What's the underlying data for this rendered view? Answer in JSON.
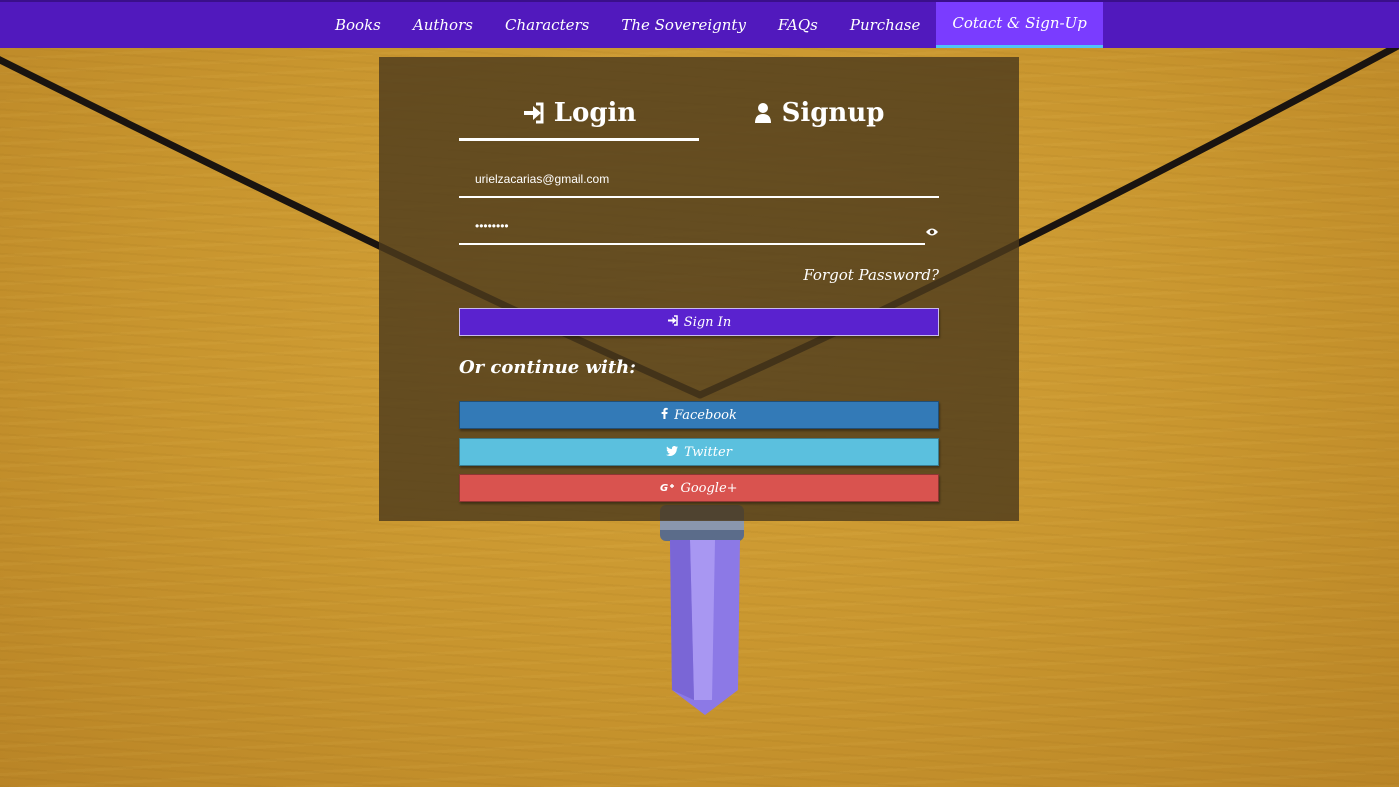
{
  "nav": {
    "items": [
      "Books",
      "Authors",
      "Characters",
      "The Sovereignty",
      "FAQs",
      "Purchase",
      "Cotact & Sign-Up"
    ],
    "active_index": 6
  },
  "auth": {
    "tabs": {
      "login": "Login",
      "signup": "Signup",
      "active": "login"
    },
    "email": {
      "value": "urielzacarias@gmail.com"
    },
    "password": {
      "value": "••••••••"
    },
    "forgot_label": "Forgot Password?",
    "signin_label": "Sign In",
    "continue_label": "Or continue with:",
    "social": {
      "facebook": "Facebook",
      "twitter": "Twitter",
      "google": "Google+"
    }
  },
  "colors": {
    "nav_bg": "#5119bd",
    "nav_active": "#7a3cff",
    "signin": "#5a22cf",
    "facebook": "#337ab7",
    "twitter": "#5bc0de",
    "google": "#d9534f",
    "panel": "#4d3a1c"
  },
  "icons": {
    "login_tab": "sign-in-icon",
    "signup_tab": "user-icon",
    "password_toggle": "eye-icon",
    "signin_button": "sign-in-icon",
    "facebook": "facebook-icon",
    "twitter": "twitter-icon",
    "google": "google-plus-icon"
  }
}
